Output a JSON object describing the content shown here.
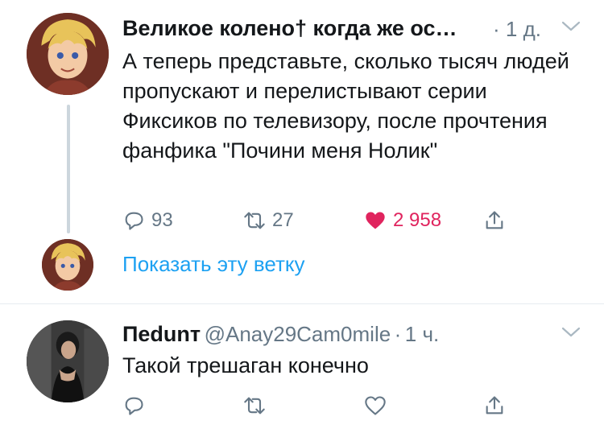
{
  "tweet1": {
    "display_name": "Великое колено",
    "name_suffix": "† когда же ос…",
    "separator": "·",
    "time": "1 д.",
    "text": "А теперь представьте, сколько тысяч людей пропускают и перелистывают серии Фиксиков по телевизору, после прочтения фанфика \"Почини меня Нолик\"",
    "replies": "93",
    "retweets": "27",
    "likes": "2 958",
    "icons": [
      "reply-icon",
      "retweet-icon",
      "heart-filled-icon",
      "share-icon",
      "chevron-down-icon"
    ]
  },
  "thread": {
    "show_label": "Показать эту ветку"
  },
  "tweet2": {
    "display_name": "Пedunт",
    "handle": "@Anay29Cam0mile",
    "separator": "·",
    "time": "1 ч.",
    "text": "Такой трешаган конечно",
    "icons": [
      "reply-icon",
      "retweet-icon",
      "heart-icon",
      "share-icon",
      "chevron-down-icon"
    ]
  },
  "colors": {
    "accent": "#1da1f2",
    "like": "#e0245e",
    "muted": "#657786",
    "text": "#14171a"
  }
}
